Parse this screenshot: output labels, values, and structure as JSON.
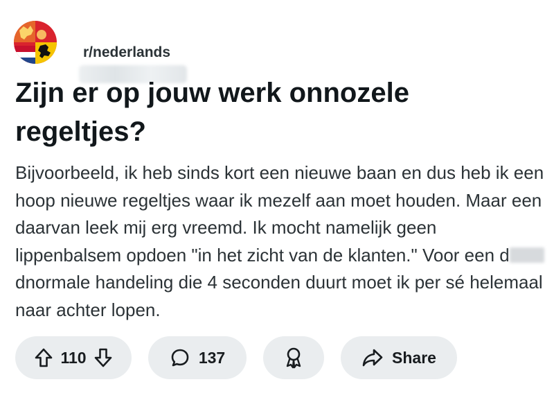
{
  "post": {
    "subreddit": "r/nederlands",
    "title": "Zijn er op jouw werk onnozele regeltjes?",
    "body_part1": "Bijvoorbeeld, ik heb sinds kort een nieuwe baan en dus heb ik een hoop nieuwe regeltjes waar ik mezelf aan moet houden. Maar een daarvan leek mij erg vreemd. Ik mocht namelijk geen lippenbalsem opdoen \"in het zicht van de klanten.\" Voor een d",
    "body_part2": "dnormale handeling die 4 seconden duurt moet ik per sé helemaal naar achter lopen."
  },
  "actions": {
    "votes": "110",
    "comments": "137",
    "share_label": "Share"
  },
  "icons": {
    "upvote": "arrow-up-outline-icon",
    "downvote": "arrow-down-outline-icon",
    "comment": "speech-bubble-icon",
    "award": "award-ribbon-icon",
    "share": "share-arrow-icon"
  },
  "colors": {
    "pill_bg": "#eaedef",
    "text": "#181c1f",
    "avatar_red": "#c8102e",
    "avatar_yellow": "#f5c400",
    "avatar_blue": "#21468b"
  }
}
